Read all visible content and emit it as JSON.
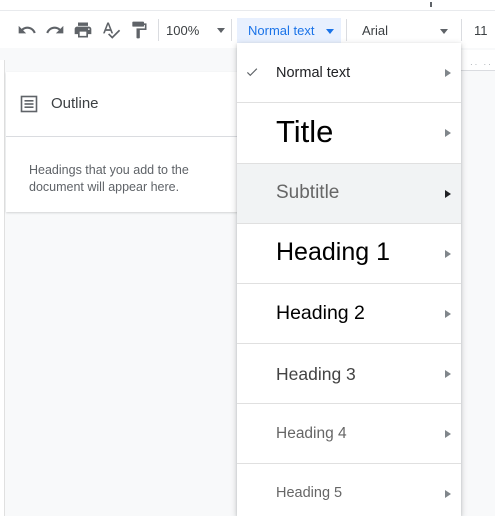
{
  "toolbar": {
    "zoom": "100%",
    "style": "Normal text",
    "font": "Arial",
    "font_size": "11"
  },
  "outline": {
    "title": "Outline",
    "empty_message": "Headings that you add to the document will appear here."
  },
  "style_menu": {
    "items": [
      {
        "label": "Normal text",
        "checked": true
      },
      {
        "label": "Title"
      },
      {
        "label": "Subtitle",
        "highlighted": true
      },
      {
        "label": "Heading 1"
      },
      {
        "label": "Heading 2"
      },
      {
        "label": "Heading 3"
      },
      {
        "label": "Heading 4"
      },
      {
        "label": "Heading 5"
      }
    ]
  },
  "colors": {
    "accent": "#1a73e8",
    "accent_bg": "#e8f0fe",
    "menu_highlight": "#f1f3f4"
  }
}
